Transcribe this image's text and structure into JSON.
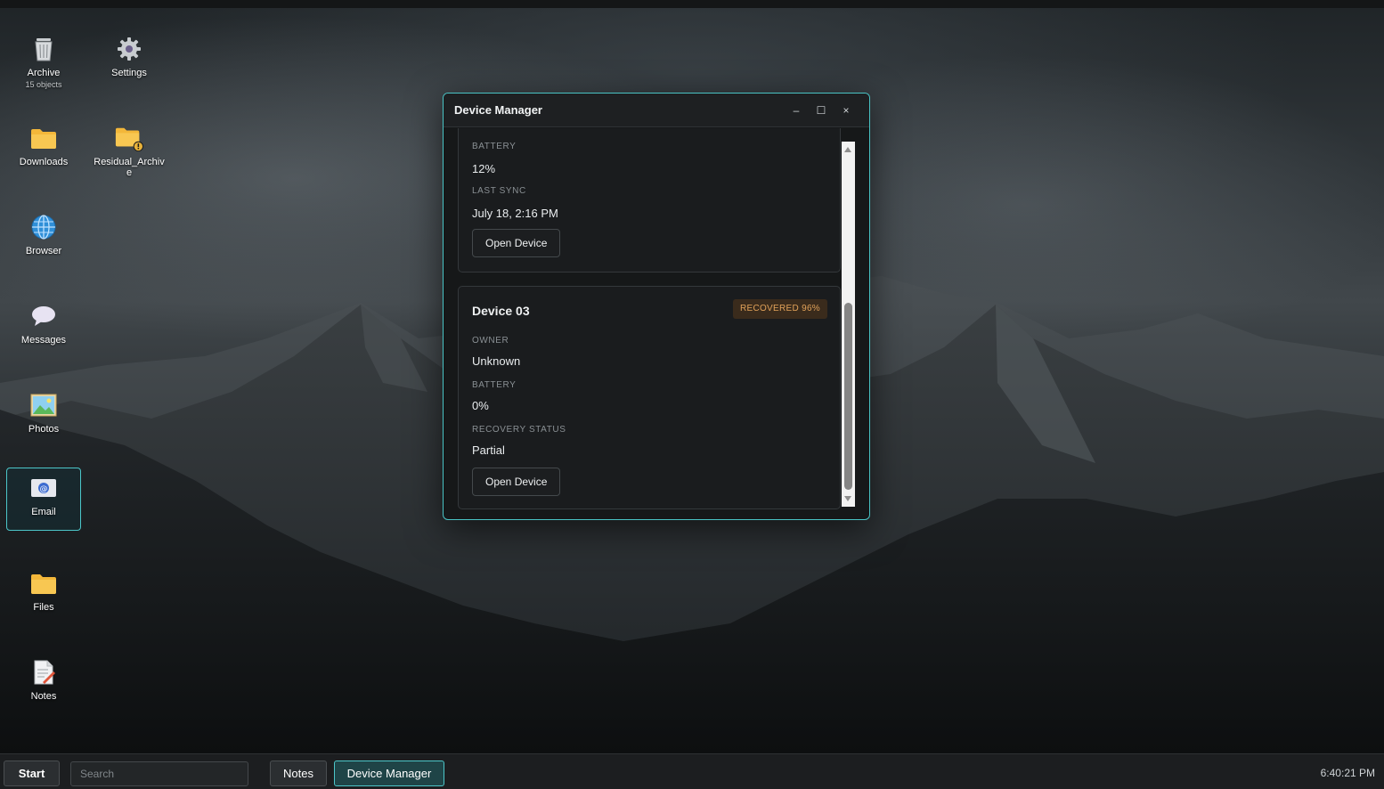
{
  "desktop_icons": [
    {
      "id": "archive",
      "label": "Archive",
      "sub": "15 objects",
      "icon": "trash-bin-icon"
    },
    {
      "id": "settings",
      "label": "Settings",
      "icon": "gear-icon"
    },
    {
      "id": "downloads",
      "label": "Downloads",
      "icon": "folder-icon"
    },
    {
      "id": "residual",
      "label": "Residual_Archive",
      "icon": "folder-warning-icon"
    },
    {
      "id": "browser",
      "label": "Browser",
      "icon": "globe-icon"
    },
    {
      "id": "messages",
      "label": "Messages",
      "icon": "chat-bubble-icon"
    },
    {
      "id": "photos",
      "label": "Photos",
      "icon": "image-icon"
    },
    {
      "id": "email",
      "label": "Email",
      "icon": "email-icon"
    },
    {
      "id": "files",
      "label": "Files",
      "icon": "folder-icon"
    },
    {
      "id": "notes",
      "label": "Notes",
      "icon": "notepad-icon"
    }
  ],
  "window": {
    "title": "Device Manager",
    "controls": {
      "minimize": "–",
      "maximize": "☐",
      "close": "×"
    },
    "card_partial": {
      "battery_label": "BATTERY",
      "battery_value": "12%",
      "last_sync_label": "LAST SYNC",
      "last_sync_value": "July 18, 2:16 PM",
      "button": "Open Device"
    },
    "card_device03": {
      "title": "Device 03",
      "badge": "RECOVERED 96%",
      "owner_label": "OWNER",
      "owner_value": "Unknown",
      "battery_label": "BATTERY",
      "battery_value": "0%",
      "recovery_label": "RECOVERY STATUS",
      "recovery_value": "Partial",
      "button": "Open Device"
    }
  },
  "taskbar": {
    "start": "Start",
    "search_placeholder": "Search",
    "tasks": [
      "Notes",
      "Device Manager"
    ],
    "clock": "6:40:21 PM"
  },
  "colors": {
    "accent": "#49c3c4",
    "badge_text": "#e2a259",
    "badge_bg": "#3a2b1c",
    "window_bg": "#161819"
  }
}
